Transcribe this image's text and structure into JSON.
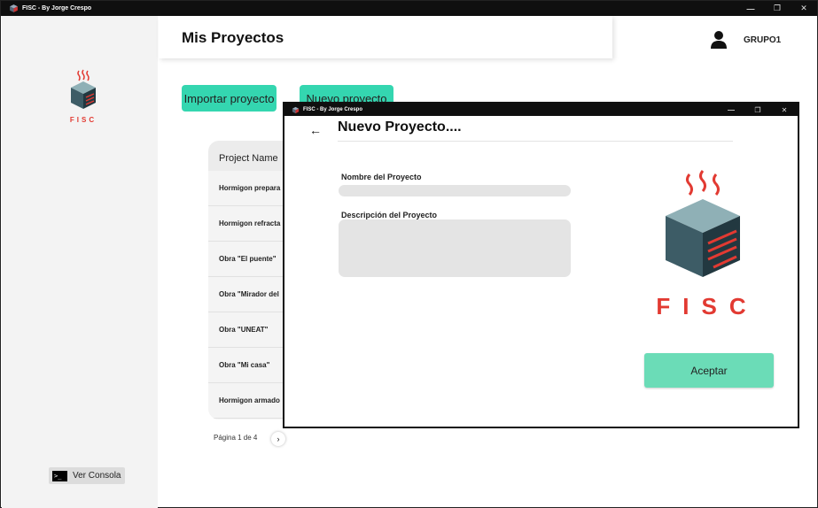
{
  "window": {
    "title": "FISC - By Jorge Crespo",
    "controls": {
      "minimize": "—",
      "maximize": "❐",
      "close": "✕"
    }
  },
  "sidebar": {
    "logo_text": "FISC",
    "console_button": {
      "icon": "terminal-icon",
      "label": "Ver Consola"
    }
  },
  "header": {
    "title": "Mis Proyectos",
    "user": {
      "icon": "user-icon",
      "name": "GRUPO1"
    }
  },
  "toolbar": {
    "import_label": "Importar proyecto",
    "new_label": "Nuevo proyecto"
  },
  "projects": {
    "column_header": "Project Name",
    "rows": [
      "Hormigon prepara",
      "Hormigon refracta",
      "Obra \"El puente\"",
      "Obra \"Mirador del",
      "Obra \"UNEAT\"",
      "Obra \"Mi casa\"",
      "Hormigon armado"
    ],
    "pager_text": "Página 1 de 4",
    "pager_next": "›"
  },
  "dialog": {
    "window_title": "FISC - By Jorge Crespo",
    "back_icon": "←",
    "title": "Nuevo Proyecto....",
    "name_label": "Nombre del Proyecto",
    "name_value": "",
    "description_label": "Descripción del Proyecto",
    "description_value": "",
    "logo_text": "FISC",
    "accept_label": "Aceptar"
  },
  "colors": {
    "accent_green": "#34d6b0",
    "accept_green": "#6bdcb7",
    "logo_red": "#e23a32",
    "titlebar": "#0f0f0f"
  }
}
